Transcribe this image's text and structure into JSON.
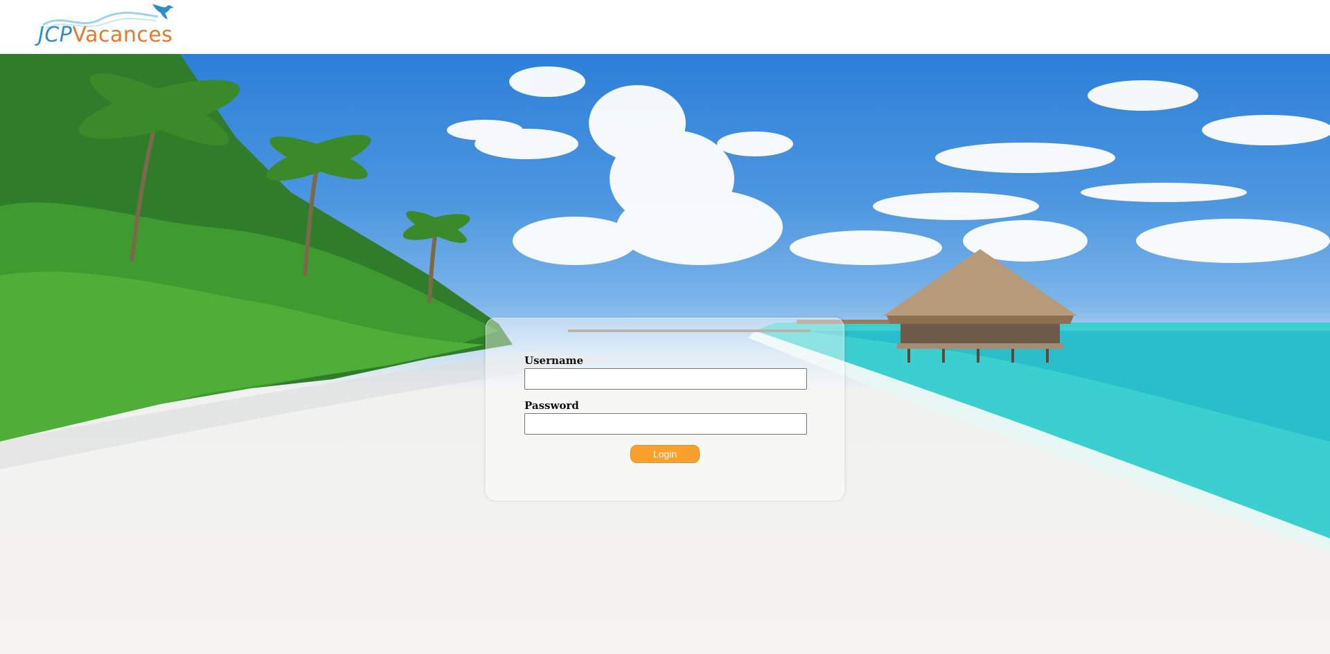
{
  "brand": {
    "logo_name": "JCPVacances",
    "logo_part1": "JCP",
    "logo_part2": "Vacances",
    "colors": {
      "blue": "#2f8ec9",
      "orange": "#e5782d"
    }
  },
  "login": {
    "username_label": "Username",
    "username_value": "",
    "password_label": "Password",
    "password_value": "",
    "button_label": "Login",
    "button_color": "#fba02c"
  },
  "background": {
    "icon": "tropical-beach-photo"
  }
}
